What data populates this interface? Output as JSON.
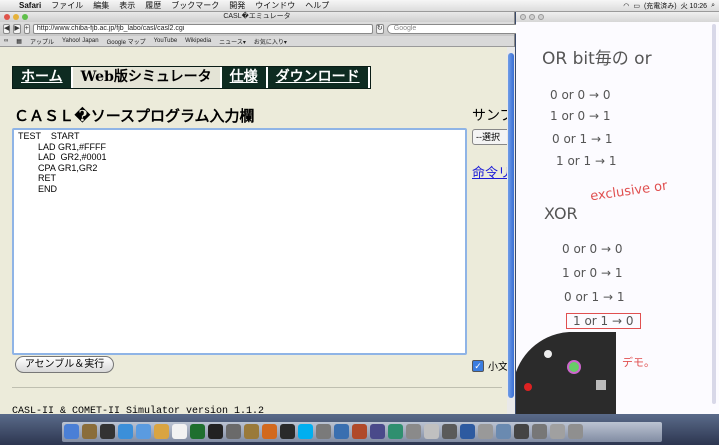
{
  "menubar": {
    "app": "Safari",
    "items": [
      "ファイル",
      "編集",
      "表示",
      "履歴",
      "ブックマーク",
      "開発",
      "ウインドウ",
      "ヘルプ"
    ],
    "battery": "(充電済み)",
    "clock": "火 10:26"
  },
  "browser": {
    "title": "CASL�エミュレータ",
    "url": "http://www.chiba-fjb.ac.jp/fjb_labo/casl/casl2.cgi",
    "search_placeholder": "Google",
    "bookmarks": [
      "アップル",
      "Yahoo! Japan",
      "Google マップ",
      "YouTube",
      "Wikipedia",
      "ニュース▾",
      "お気に入り▾"
    ]
  },
  "nav": {
    "tabs": [
      "ホーム",
      "Web版シミュレータ",
      "仕様",
      "ダウンロード"
    ]
  },
  "page": {
    "heading": "ＣＡＳＬ�ソースプログラム入力欄",
    "sample_label": "サンプ",
    "select_value": "--選択",
    "command_link": "命令リ",
    "source": "TEST    START\n        LAD GR1,#FFFF\n        LAD  GR2,#0001\n        CPA GR1,GR2\n        RET\n        END",
    "assemble_button": "アセンブル＆実行",
    "checkbox_label": "小文",
    "version": "CASL-II & COMET-II Simulator version 1.1.2"
  },
  "notes": {
    "or_title": "OR   bit毎の or",
    "or_rows": [
      "0  or  0 → 0",
      "1  or  0 → 1",
      "0  or  1 → 1",
      "1  or  1 → 1"
    ],
    "xor_title": "XOR",
    "xor_note": "exclusive or",
    "xor_rows": [
      "0  or  0 → 0",
      "1  or  0 → 1",
      "0  or  1 → 1",
      "1  or  1 → 0"
    ],
    "demo": "デモ。"
  },
  "colors": {
    "nav_bg": "#0e2b21",
    "ink_red": "#e05050",
    "ink_gray": "#555555"
  }
}
